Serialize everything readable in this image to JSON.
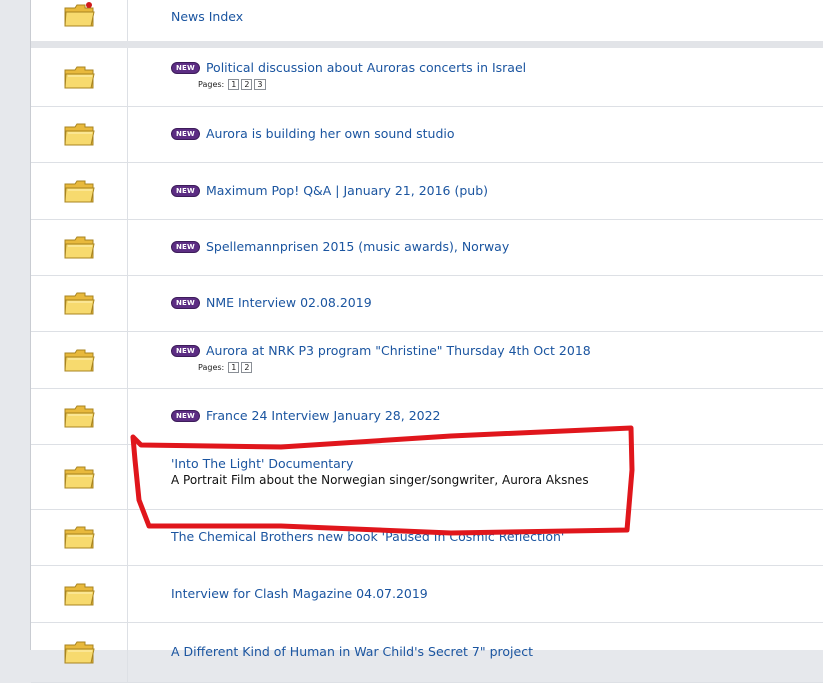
{
  "news_index_label": "News Index",
  "new_badge_text": "NEW",
  "pages_label": "Pages:",
  "topics": [
    {
      "title": "Political discussion about Auroras concerts in Israel",
      "new": true,
      "pages": [
        "1",
        "2",
        "3"
      ]
    },
    {
      "title": "Aurora is building her own sound studio",
      "new": true
    },
    {
      "title": "Maximum Pop! Q&A | January 21, 2016 (pub)",
      "new": true
    },
    {
      "title": "Spellemannprisen 2015 (music awards), Norway",
      "new": true
    },
    {
      "title": "NME Interview 02.08.2019",
      "new": true
    },
    {
      "title": "Aurora at NRK P3 program \"Christine\" Thursday 4th Oct 2018",
      "new": true,
      "pages": [
        "1",
        "2"
      ]
    },
    {
      "title": "France 24 Interview January 28, 2022",
      "new": true
    },
    {
      "title": "'Into The Light' Documentary",
      "new": false,
      "description": "A Portrait Film about the Norwegian singer/songwriter, Aurora Aksnes"
    },
    {
      "title": "The Chemical Brothers new book 'Paused In Cosmic Reflection'",
      "new": false
    },
    {
      "title": "Interview for Clash Magazine 04.07.2019",
      "new": false
    },
    {
      "title": "A Different Kind of Human in War Child's Secret 7\" project",
      "new": false
    }
  ],
  "colors": {
    "link": "#1b55a0",
    "new_badge": "#5c2d83",
    "annotation": "#e0161c",
    "folder": "#f3cf5b"
  }
}
